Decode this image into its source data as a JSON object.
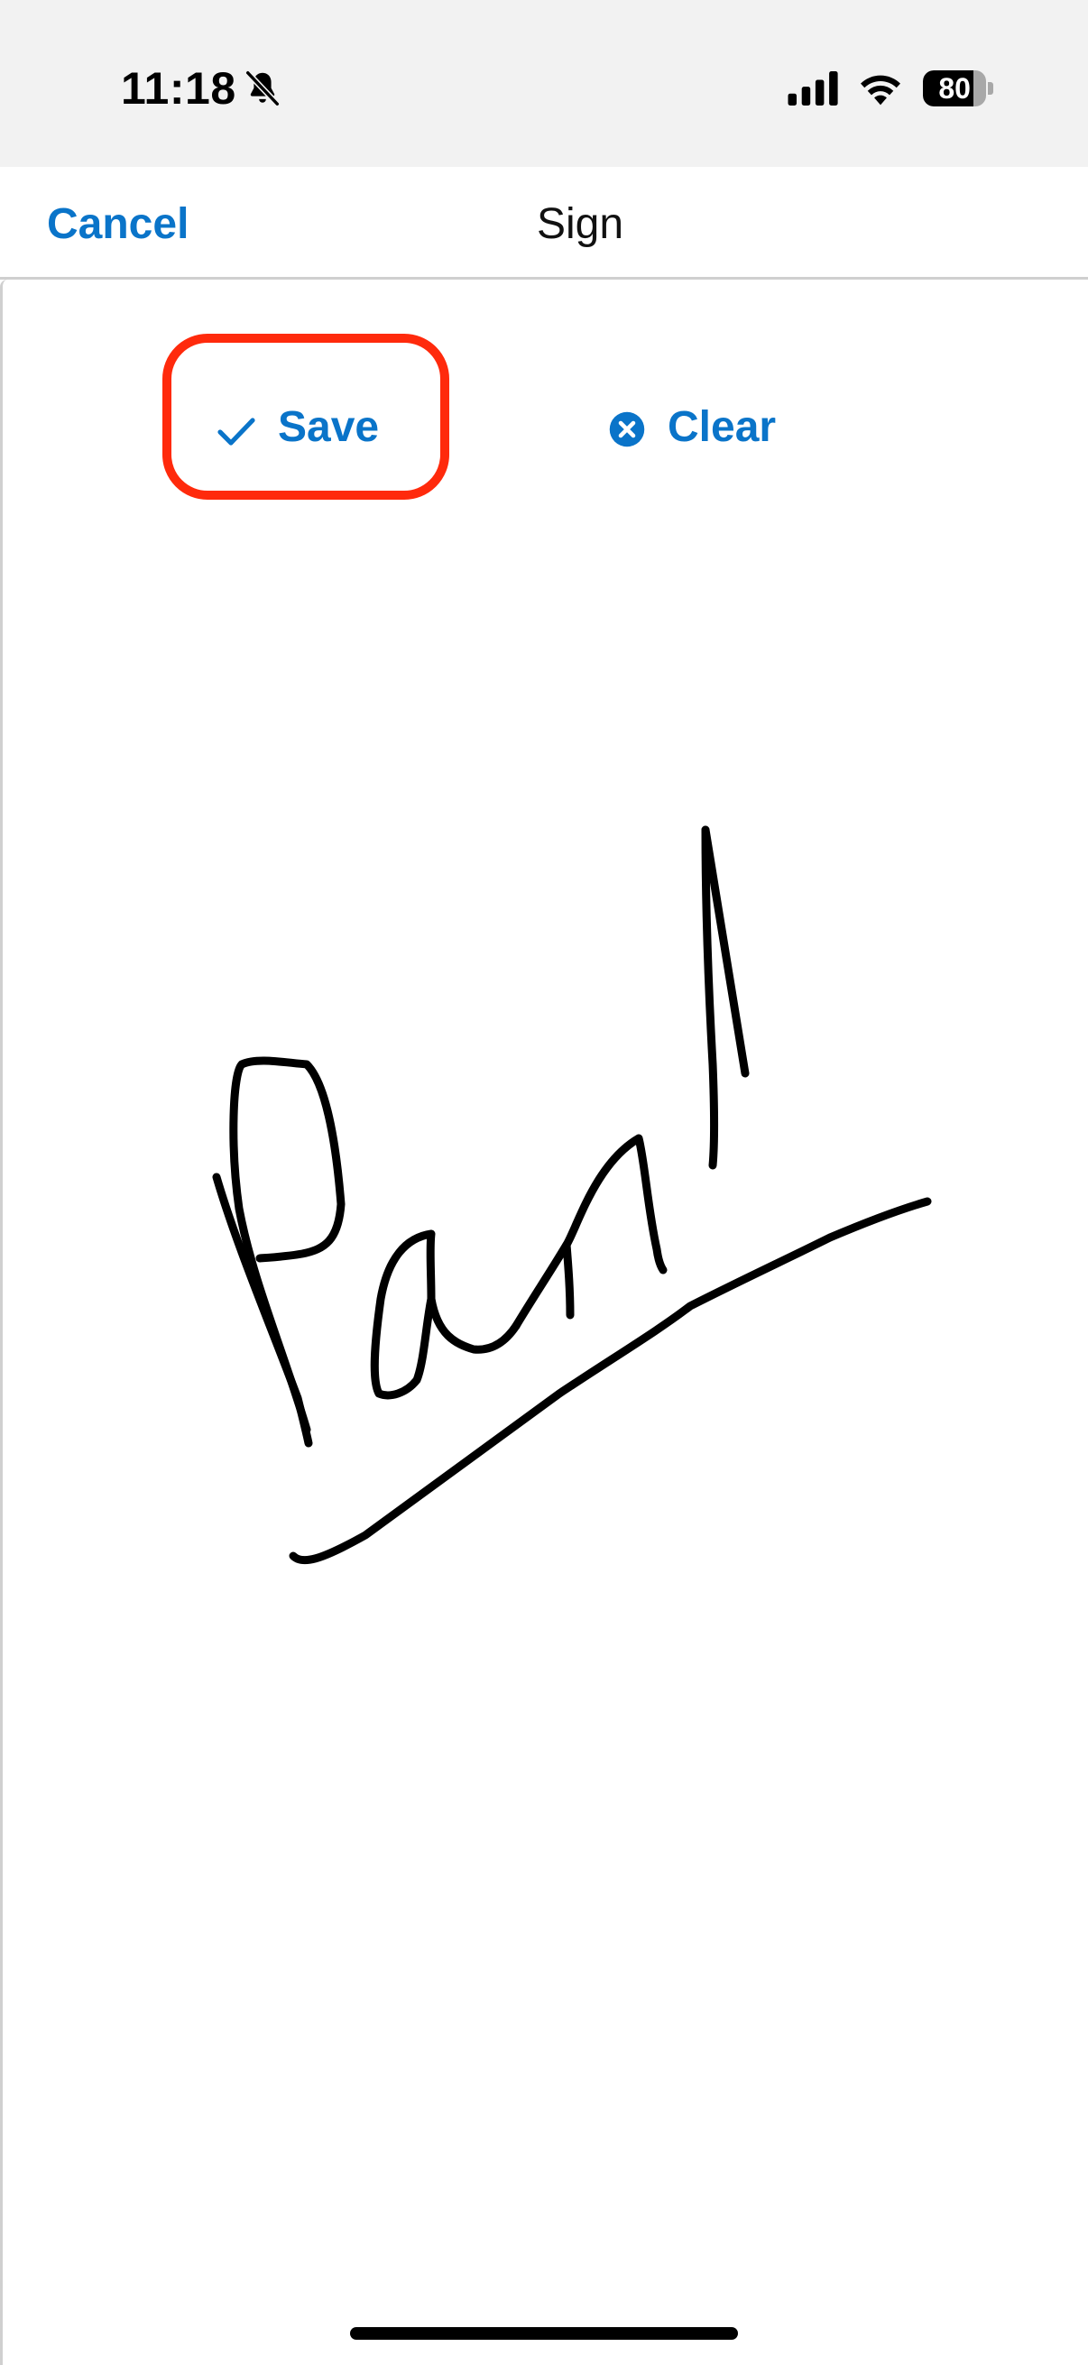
{
  "status_bar": {
    "time": "11:18",
    "battery_percent": "80",
    "battery_level": 0.8,
    "icons": [
      "bell-slash-icon",
      "signal-icon",
      "wifi-icon",
      "battery-icon"
    ]
  },
  "nav": {
    "cancel_label": "Cancel",
    "title": "Sign"
  },
  "toolbar": {
    "save_label": "Save",
    "clear_label": "Clear",
    "save_icon": "check-icon",
    "clear_icon": "x-circle-icon"
  },
  "colors": {
    "accent": "#0a74c9",
    "highlight": "#ff2a0c",
    "status_bar_bg": "#f2f2f2",
    "ink": "#000000"
  }
}
